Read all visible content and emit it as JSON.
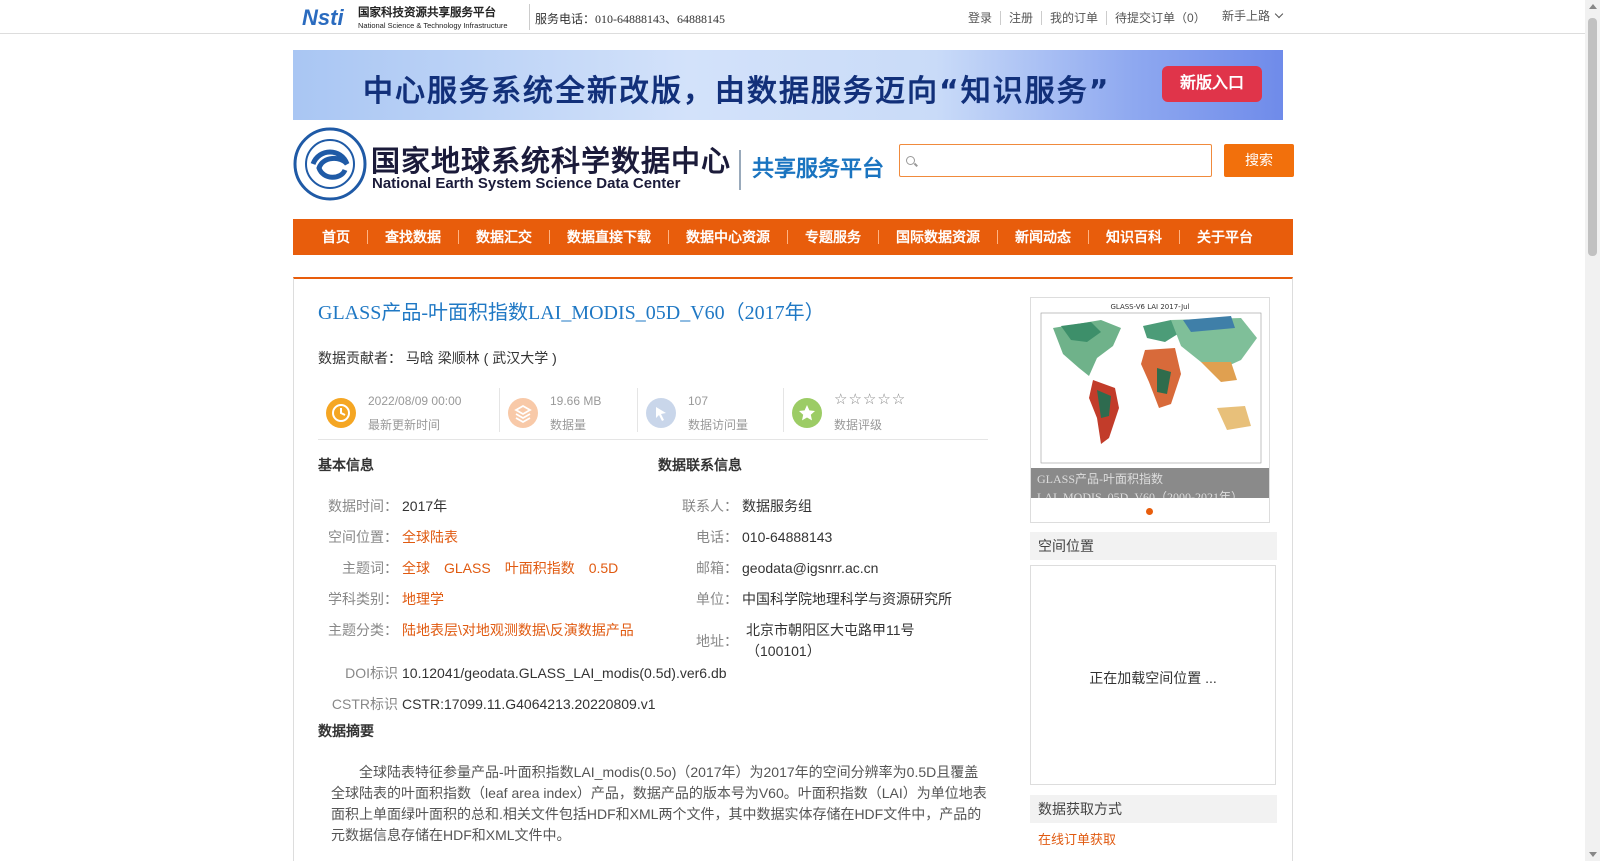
{
  "topbar": {
    "logo_cn": "国家科技资源共享服务平台",
    "logo_en": "National Science & Technology Infrastructure",
    "phone": "服务电话：010-64888143、64888145",
    "links": [
      "登录",
      "注册",
      "我的订单",
      "待提交订单（0）"
    ],
    "guide": "新手上路"
  },
  "banner": {
    "text": "中心服务系统全新改版，由数据服务迈向“知识服务”",
    "button": "新版入口"
  },
  "header": {
    "logo_cn": "国家地球系统科学数据中心",
    "logo_en": "National Earth System Science Data Center",
    "platform": "共享服务平台",
    "search_placeholder": "",
    "search_button": "搜索"
  },
  "nav": [
    "首页",
    "查找数据",
    "数据汇交",
    "数据直接下载",
    "数据中心资源",
    "专题服务",
    "国际数据资源",
    "新闻动态",
    "知识百科",
    "关于平台"
  ],
  "dataset": {
    "title": "GLASS产品-叶面积指数LAI_MODIS_05D_V60（2017年）",
    "contributor_label": "数据贡献者：",
    "contributor": "马晗 梁顺林 ( 武汉大学 )",
    "stats": [
      {
        "value": "2022/08/09 00:00",
        "label": "最新更新时间",
        "color": "#f5a623"
      },
      {
        "value": "19.66 MB",
        "label": "数据量",
        "color": "#f8c9a8"
      },
      {
        "value": "107",
        "label": "数据访问量",
        "color": "#c9d6ea"
      },
      {
        "value": "☆☆☆☆☆",
        "label": "数据评级",
        "color": "#9ccc65"
      }
    ],
    "basic_head": "基本信息",
    "contact_head": "数据联系信息",
    "basic": {
      "time_k": "数据时间：",
      "time_v": "2017年",
      "space_k": "空间位置：",
      "space_v": "全球陆表",
      "kw_k": "主题词：",
      "kw": [
        "全球",
        "GLASS",
        "叶面积指数",
        "0.5D"
      ],
      "subj_k": "学科类别：",
      "subj_v": "地理学",
      "cat_k": "主题分类：",
      "cat_v": "陆地表层\\对地观测数据\\反演数据产品",
      "doi_k": "DOI标识",
      "doi_v": "10.12041/geodata.GLASS_LAI_modis(0.5d).ver6.db",
      "cstr_k": "CSTR标识",
      "cstr_v": "CSTR:17099.11.G4064213.20220809.v1"
    },
    "contact": {
      "person_k": "联系人：",
      "person_v": "数据服务组",
      "tel_k": "电话：",
      "tel_v": "010-64888143",
      "mail_k": "邮箱：",
      "mail_v": "geodata@igsnrr.ac.cn",
      "org_k": "单位：",
      "org_v": "中国科学院地理科学与资源研究所",
      "addr_k": "地址：",
      "addr_v1": "北京市朝阳区大屯路甲11号",
      "addr_v2": "（100101）"
    },
    "abstract_head": "数据摘要",
    "abstract": "全球陆表特征参量产品-叶面积指数LAI_modis(0.5o)（2017年）为2017年的空间分辨率为0.5D且覆盖全球陆表的叶面积指数（leaf area index）产品，数据产品的版本号为V60。叶面积指数（LAI）为单位地表面积上单面绿叶面积的总和.相关文件包括HDF和XML两个文件，其中数据实体存储在HDF文件中，产品的元数据信息存储在HDF和XML文件中。"
  },
  "sidebar": {
    "map_title": "GLASS-V6 LAI 2017-Jul",
    "caption": "GLASS产品-叶面积指数LAI_MODIS_05D_V60（2000-2021年）",
    "space_head": "空间位置",
    "space_loading": "正在加载空间位置 ...",
    "access_head": "数据获取方式",
    "access_link": "在线订单获取"
  }
}
